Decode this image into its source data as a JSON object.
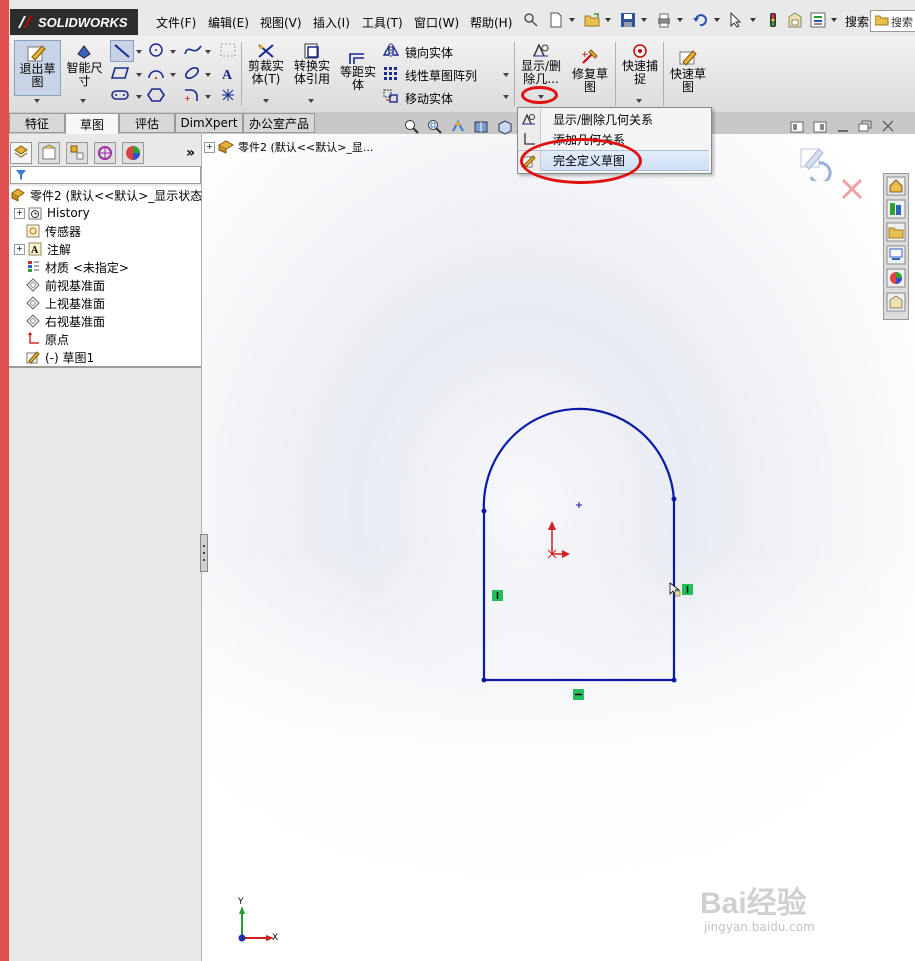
{
  "app": {
    "logo_text": "SOLIDWORKS"
  },
  "menu": {
    "items": [
      "文件(F)",
      "编辑(E)",
      "视图(V)",
      "插入(I)",
      "工具(T)",
      "窗口(W)",
      "帮助(H)"
    ],
    "search_placeholder": "搜索",
    "search_short": "搜索"
  },
  "toolbar": {
    "exit_sketch": "退出草图",
    "smart_dim_line1": "智能尺",
    "smart_dim_line2": "寸",
    "trim_line1": "剪裁实",
    "trim_line2": "体(T)",
    "convert_line1": "转换实",
    "convert_line2": "体引用",
    "offset_line1": "等距实",
    "offset_line2": "体",
    "mirror": "镜向实体",
    "linear_pattern": "线性草图阵列",
    "move": "移动实体",
    "display_rel_line1": "显示/删",
    "display_rel_line2": "除几...",
    "repair_line1": "修复草",
    "repair_line2": "图",
    "quick_snap_line1": "快速捕",
    "quick_snap_line2": "捉",
    "rapid_sketch_line1": "快速草",
    "rapid_sketch_line2": "图"
  },
  "tabs": [
    {
      "label": "特征",
      "active": false
    },
    {
      "label": "草图",
      "active": true
    },
    {
      "label": "评估",
      "active": false
    },
    {
      "label": "DimXpert",
      "active": false
    },
    {
      "label": "办公室产品",
      "active": false
    }
  ],
  "dropdown": {
    "items": [
      "显示/删除几何关系",
      "添加几何关系",
      "完全定义草图"
    ],
    "highlighted_index": 2
  },
  "feature_tree": {
    "root": "零件2 (默认<<默认>_显示状态",
    "items": [
      {
        "label": "History",
        "icon": "history-icon",
        "expandable": true
      },
      {
        "label": "传感器",
        "icon": "sensor-icon",
        "expandable": false
      },
      {
        "label": "注解",
        "icon": "annotation-icon",
        "expandable": true
      },
      {
        "label": "材质 <未指定>",
        "icon": "material-icon",
        "expandable": false
      },
      {
        "label": "前视基准面",
        "icon": "plane-icon",
        "expandable": false
      },
      {
        "label": "上视基准面",
        "icon": "plane-icon",
        "expandable": false
      },
      {
        "label": "右视基准面",
        "icon": "plane-icon",
        "expandable": false
      },
      {
        "label": "原点",
        "icon": "origin-icon",
        "expandable": false
      },
      {
        "label": "(-) 草图1",
        "icon": "sketch-icon",
        "expandable": false
      }
    ]
  },
  "graphics": {
    "flyout_tree_label": "零件2 (默认<<默认>_显...",
    "triad_y": "Y",
    "triad_x": "X",
    "sketch_color": "#0a1aa8",
    "relation_color": "#22c05a"
  },
  "watermark": {
    "line1": "Bai经验",
    "line2": "jingyan.baidu.com"
  },
  "colors": {
    "annotation": "#e01010",
    "logo_bg": "#2d2d2d",
    "accent": "#e05050"
  }
}
